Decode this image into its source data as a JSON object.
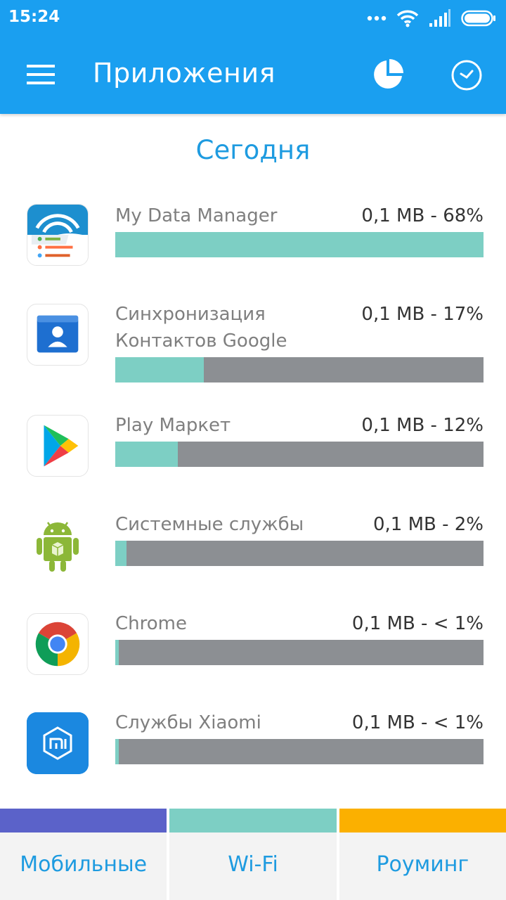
{
  "status_bar": {
    "time": "15:24"
  },
  "toolbar": {
    "title": "Приложения"
  },
  "section": {
    "title": "Сегодня"
  },
  "apps": [
    {
      "name": "My Data Manager",
      "usage": "0,1 MB - 68%",
      "percent": 100,
      "icon": "my-data-manager-icon"
    },
    {
      "name": "Синхронизация\nКонтактов Google",
      "usage": "0,1 MB - 17%",
      "percent": 24,
      "icon": "google-contacts-sync-icon"
    },
    {
      "name": "Play Маркет",
      "usage": "0,1 MB - 12%",
      "percent": 17,
      "icon": "play-market-icon"
    },
    {
      "name": "Системные службы",
      "usage": "0,1 MB - 2%",
      "percent": 3,
      "icon": "android-system-icon"
    },
    {
      "name": "Chrome",
      "usage": "0,1 MB - < 1%",
      "percent": 1,
      "icon": "chrome-icon"
    },
    {
      "name": "Службы Xiaomi",
      "usage": "0,1 MB - < 1%",
      "percent": 1,
      "icon": "xiaomi-services-icon"
    }
  ],
  "tabs": [
    {
      "label": "Мобильные",
      "color": "#5b62c9"
    },
    {
      "label": "Wi-Fi",
      "color": "#7dcfc4"
    },
    {
      "label": "Роуминг",
      "color": "#fbb000"
    }
  ],
  "colors": {
    "header": "#1a9ff0",
    "accent_text": "#1e9be0",
    "bar_track": "#8c8f93",
    "bar_fill": "#7dcfc4"
  }
}
